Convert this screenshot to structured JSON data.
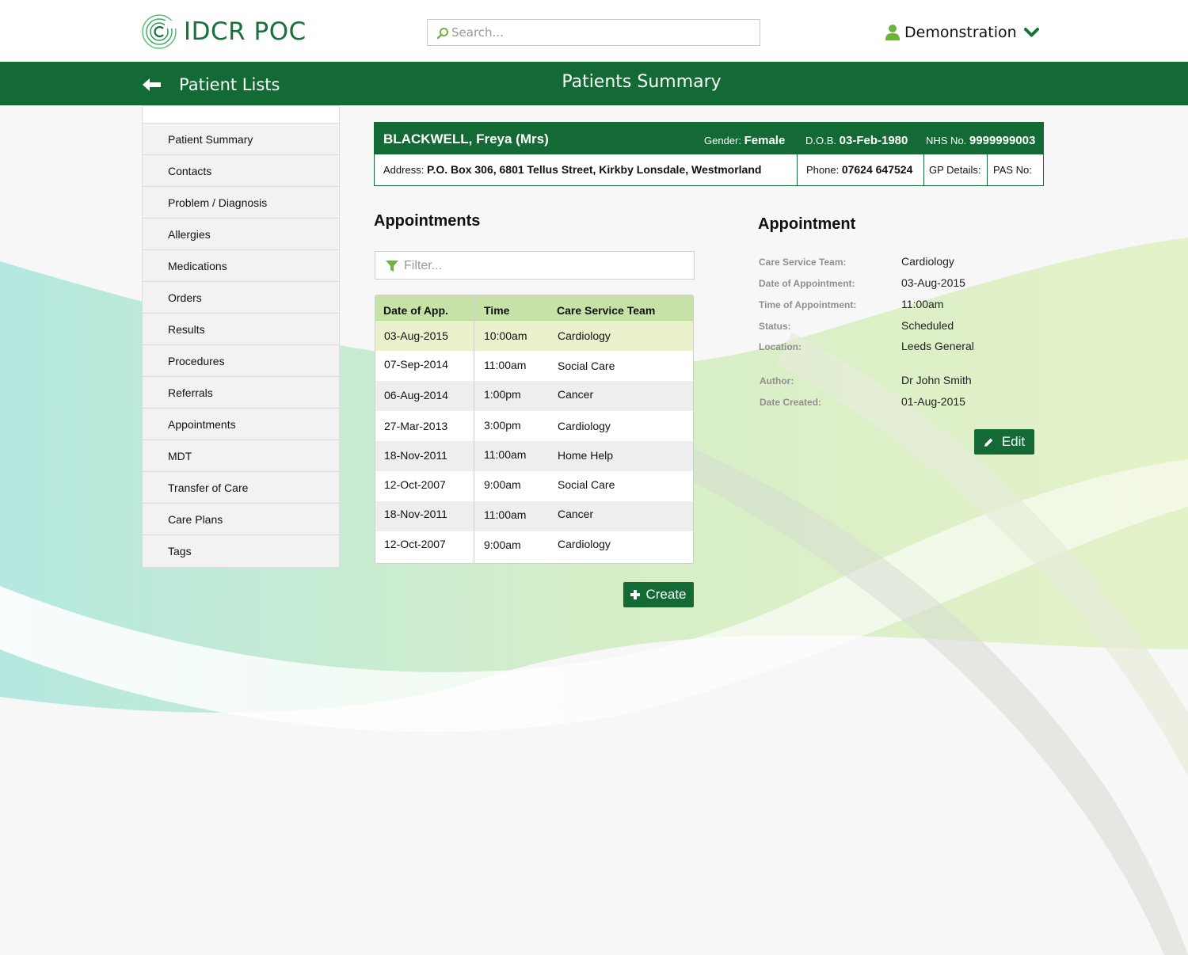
{
  "app": {
    "title": "IDCR POC"
  },
  "search": {
    "placeholder": "Search..."
  },
  "user": {
    "name": "Demonstration"
  },
  "nav": {
    "back_label": "Patient Lists",
    "page_title": "Patients Summary"
  },
  "sidebar": {
    "items": [
      {
        "label": "Patient Summary"
      },
      {
        "label": "Contacts"
      },
      {
        "label": "Problem / Diagnosis"
      },
      {
        "label": "Allergies"
      },
      {
        "label": "Medications"
      },
      {
        "label": "Orders"
      },
      {
        "label": "Results"
      },
      {
        "label": "Procedures"
      },
      {
        "label": "Referrals"
      },
      {
        "label": "Appointments"
      },
      {
        "label": "MDT"
      },
      {
        "label": "Transfer of Care"
      },
      {
        "label": "Care Plans"
      },
      {
        "label": "Tags"
      }
    ]
  },
  "patient": {
    "name": "BLACKWELL, Freya (Mrs)",
    "gender_label": "Gender:",
    "gender": "Female",
    "dob_label": "D.O.B.",
    "dob": "03-Feb-1980",
    "nhs_label": "NHS No.",
    "nhs": "9999999003",
    "address_label": "Address:",
    "address": "P.O. Box 306, 6801 Tellus Street, Kirkby Lonsdale, Westmorland",
    "phone_label": "Phone:",
    "phone": "07624 647524",
    "gp_label": "GP Details:",
    "pas_label": "PAS No:"
  },
  "appointments": {
    "heading": "Appointments",
    "filter_placeholder": "Filter...",
    "columns": {
      "date": "Date of App.",
      "time": "Time",
      "team": "Care Service Team"
    },
    "rows": [
      {
        "date": "03-Aug-2015",
        "time": "10:00am",
        "team": "Cardiology"
      },
      {
        "date": "07-Sep-2014",
        "time": "11:00am",
        "team": "Social Care"
      },
      {
        "date": "06-Aug-2014",
        "time": "1:00pm",
        "team": "Cancer"
      },
      {
        "date": "27-Mar-2013",
        "time": "3:00pm",
        "team": "Cardiology"
      },
      {
        "date": "18-Nov-2011",
        "time": "11:00am",
        "team": "Home Help"
      },
      {
        "date": "12-Oct-2007",
        "time": "9:00am",
        "team": "Social Care"
      },
      {
        "date": "18-Nov-2011",
        "time": "11:00am",
        "team": "Cancer"
      },
      {
        "date": "12-Oct-2007",
        "time": "9:00am",
        "team": "Cardiology"
      }
    ],
    "create_label": "Create"
  },
  "detail": {
    "heading": "Appointment",
    "fields": [
      {
        "label": "Care Service Team:",
        "value": "Cardiology"
      },
      {
        "label": "Date of Appointment:",
        "value": "03-Aug-2015"
      },
      {
        "label": "Time of Appointment:",
        "value": "11:00am"
      },
      {
        "label": "Status:",
        "value": "Scheduled"
      },
      {
        "label": "Location:",
        "value": "Leeds General"
      },
      {
        "label": "Author:",
        "value": "Dr John Smith"
      },
      {
        "label": "Date Created:",
        "value": "01-Aug-2015"
      }
    ],
    "edit_label": "Edit"
  },
  "colors": {
    "brand_green": "#136a35",
    "header_row": "#c6e2a6",
    "selected_row": "#ebf1cc",
    "logo_green": "#17713a"
  }
}
